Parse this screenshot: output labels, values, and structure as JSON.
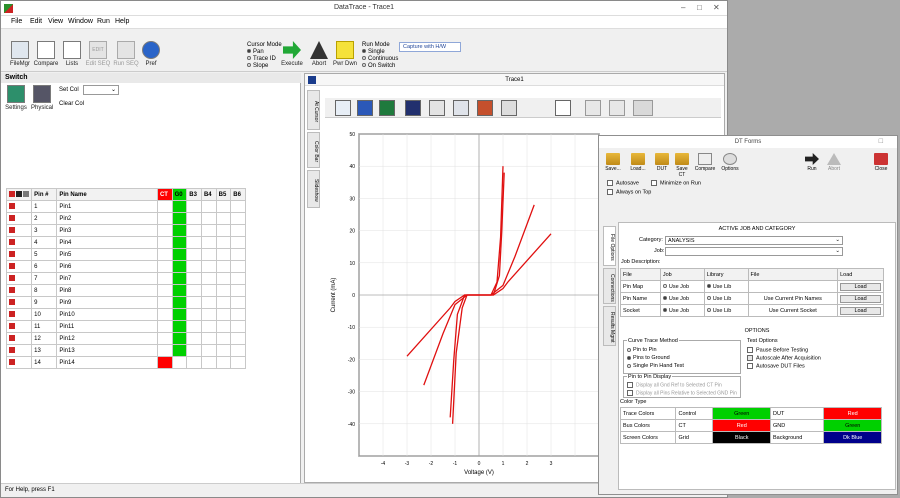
{
  "app": {
    "title": "DataTrace - Trace1"
  },
  "menu": [
    "File",
    "Edit",
    "View",
    "Window",
    "Run",
    "Help"
  ],
  "toolbar": {
    "buttons": [
      {
        "label": "FileMgr",
        "icon": "file-manager-icon"
      },
      {
        "label": "Compare",
        "icon": "compare-icon"
      },
      {
        "label": "Lists",
        "icon": "lists-icon"
      },
      {
        "label": "Edit SEQ",
        "icon": "edit-seq-icon",
        "sub": "EDIT",
        "disabled": true
      },
      {
        "label": "Run SEQ",
        "icon": "run-seq-icon",
        "disabled": true
      },
      {
        "label": "Pref",
        "icon": "gear-icon"
      }
    ],
    "cursor_mode": {
      "title": "Cursor Mode",
      "options": [
        "Pan",
        "Trace ID",
        "Slope"
      ],
      "selected": 0
    },
    "execute_label": "Execute",
    "abort_label": "Abort",
    "pwr_dwn_label": "Pwr Dwn",
    "run_mode": {
      "title": "Run Mode",
      "options": [
        "Single",
        "Continuous",
        "On Switch"
      ],
      "selected": 0
    },
    "capture_label": "Capture with H/W"
  },
  "switch_panel": {
    "title": "Switch",
    "settings_label": "Settings",
    "physical_label": "Physical",
    "set_col_label": "Set Col",
    "clear_col_label": "Clear Col",
    "columns": [
      "Pin #",
      "Pin Name",
      "CT",
      "G0",
      "B3",
      "B4",
      "B5",
      "B6"
    ],
    "rows": [
      {
        "num": "1",
        "name": "Pin1"
      },
      {
        "num": "2",
        "name": "Pin2"
      },
      {
        "num": "3",
        "name": "Pin3"
      },
      {
        "num": "4",
        "name": "Pin4"
      },
      {
        "num": "5",
        "name": "Pin5"
      },
      {
        "num": "6",
        "name": "Pin6"
      },
      {
        "num": "7",
        "name": "Pin7"
      },
      {
        "num": "8",
        "name": "Pin8"
      },
      {
        "num": "9",
        "name": "Pin9"
      },
      {
        "num": "10",
        "name": "Pin10"
      },
      {
        "num": "11",
        "name": "Pin11"
      },
      {
        "num": "12",
        "name": "Pin12"
      },
      {
        "num": "13",
        "name": "Pin13"
      },
      {
        "num": "14",
        "name": "Pin14"
      }
    ]
  },
  "trace_window": {
    "title": "Trace1",
    "side_tabs": [
      "At Cursor",
      "Color Bar",
      "Slideshow"
    ]
  },
  "chart_data": {
    "type": "line",
    "xlabel": "Voltage (V)",
    "ylabel": "Current (mA)",
    "xlim": [
      -5,
      5
    ],
    "ylim": [
      -50,
      50
    ],
    "xticks": [
      "-4",
      "-3",
      "-2",
      "-1",
      "0",
      "1",
      "2",
      "3"
    ],
    "yticks": [
      "50",
      "40",
      "30",
      "20",
      "10",
      "0",
      "-10",
      "-20",
      "-30",
      "-40"
    ],
    "series": [
      {
        "x": [
          -3.0,
          -1.2,
          -1.0,
          -0.6,
          0.6,
          1.0,
          1.2,
          3.0
        ],
        "y": [
          -19,
          -4,
          -2,
          0,
          0,
          2,
          4,
          19
        ]
      },
      {
        "x": [
          -1.2,
          -1.05,
          -0.9,
          -0.6,
          0.6,
          0.85,
          0.95,
          1.05
        ],
        "y": [
          -38,
          -20,
          -6,
          0,
          0,
          6,
          20,
          38
        ]
      },
      {
        "x": [
          -1.1,
          -0.95,
          -0.7,
          -0.5,
          0.5,
          0.75,
          0.9,
          1.0
        ],
        "y": [
          -40,
          -18,
          -4,
          0,
          0,
          4,
          18,
          40
        ]
      },
      {
        "x": [
          -2.3,
          -1.5,
          -1.0,
          -0.5,
          0.5,
          1.0,
          1.5,
          2.3
        ],
        "y": [
          -28,
          -12,
          -3,
          0,
          0,
          3,
          12,
          28
        ]
      }
    ]
  },
  "dt_forms": {
    "title": "DT Forms",
    "buttons": [
      "Save...",
      "Load...",
      "DUT",
      "Save CT",
      "Compare",
      "Options",
      "Run",
      "Abort",
      "Close"
    ],
    "autosave_label": "Autosave",
    "minimize_label": "Minimize on Run",
    "ontop_label": "Always on Top",
    "side_tabs": [
      "File Options",
      "Connections",
      "Results Mgmt"
    ],
    "active_title": "ACTIVE JOB AND CATEGORY",
    "category_label": "Category:",
    "category_value": "ANALYSIS",
    "job_label": "Job:",
    "job_desc_label": "Job Description:",
    "file_table": {
      "headers": [
        "File",
        "Job",
        "Library",
        "File",
        "Load"
      ],
      "rows": [
        {
          "name": "Pin Map",
          "job": "Use Job",
          "lib": "Use Lib",
          "file": "DIP-14",
          "load": "Load"
        },
        {
          "name": "Pin Name",
          "job": "Use Job",
          "lib": "Use Lib",
          "file": "Use Current Pin Names",
          "load": "Load"
        },
        {
          "name": "Socket",
          "job": "Use Job",
          "lib": "Use Lib",
          "file": "Use Current Socket",
          "load": "Load"
        }
      ]
    },
    "options_title": "OPTIONS",
    "curve_trace_title": "Curve Trace Method",
    "curve_trace_options": [
      "Pin to Pin",
      "Pins to Ground",
      "Single Pin Hand Test"
    ],
    "pin_display_title": "Pin to Pin Display",
    "pin_display_options": [
      "Display all Gnd Ref to Selected CT Pin",
      "Display all Pins Relative to Selected GND Pin"
    ],
    "test_options_title": "Test Options",
    "test_options": [
      "Pause Before Testing",
      "Autoscale After Acquisition",
      "Autosave DUT Files"
    ],
    "color_title": "Color Type",
    "colors": [
      {
        "type": "Trace Colors",
        "a": "Control",
        "av": "Green",
        "ac": "#00d000",
        "b": "DUT",
        "bv": "Red",
        "bc": "#ff0000"
      },
      {
        "type": "Bus Colors",
        "a": "CT",
        "av": "Red",
        "ac": "#ff0000",
        "b": "GND",
        "bv": "Green",
        "bc": "#00d000"
      },
      {
        "type": "Screen Colors",
        "a": "Grid",
        "av": "Black",
        "ac": "#000000",
        "b": "Background",
        "bv": "Dk Blue",
        "bc": "#00008b"
      }
    ]
  },
  "status_text": "For Help, press F1"
}
